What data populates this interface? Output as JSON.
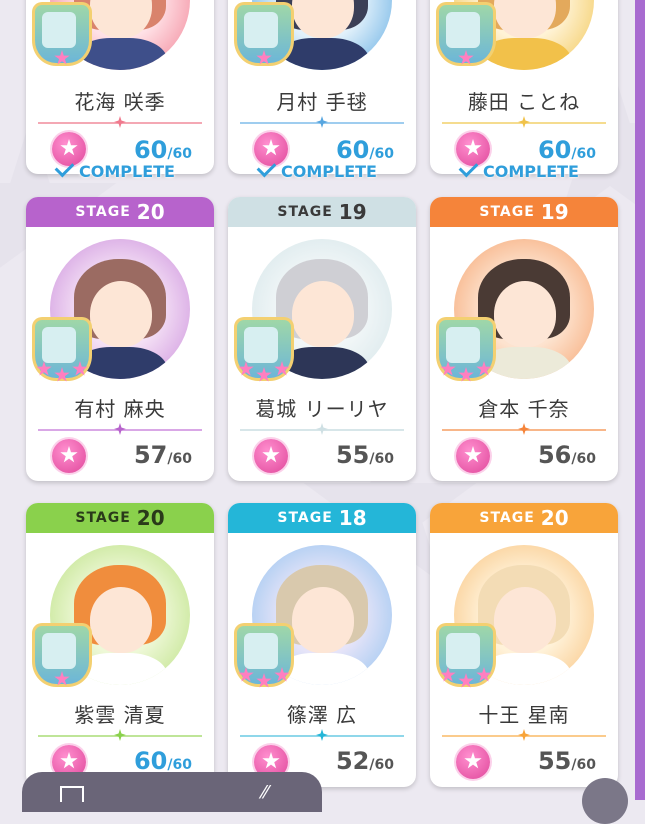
{
  "cards": [
    {
      "id": "hanami-sakiya",
      "name": "花海 咲季",
      "score": "60",
      "max": "/60",
      "full": true,
      "complete_label": "COMPLETE",
      "stage_label": "",
      "stage": "",
      "color": "#f07a8e",
      "hair": "#d9836c",
      "outfit": "#3e4f8a",
      "eye": "#4a7fd3"
    },
    {
      "id": "tsukimura-temari",
      "name": "月村 手毬",
      "score": "60",
      "max": "/60",
      "full": true,
      "complete_label": "COMPLETE",
      "stage_label": "",
      "stage": "",
      "color": "#57a6e0",
      "hair": "#3b3f56",
      "outfit": "#2f3c6a",
      "eye": "#4b6db8"
    },
    {
      "id": "fujita-kotone",
      "name": "藤田 ことね",
      "score": "60",
      "max": "/60",
      "full": true,
      "complete_label": "COMPLETE",
      "stage_label": "",
      "stage": "",
      "color": "#f0c24a",
      "hair": "#e3a95c",
      "outfit": "#f2c14a",
      "eye": "#6a8b3b"
    },
    {
      "id": "arimura-mao",
      "name": "有村 麻央",
      "score": "57",
      "max": "/60",
      "full": false,
      "complete_label": "",
      "stage_label": "STAGE",
      "stage": "20",
      "color": "#b763cc",
      "hair": "#9b6b62",
      "outfit": "#2f3c6a",
      "eye": "#6c6fd0"
    },
    {
      "id": "katsuragi-lilja",
      "name": "葛城 リーリヤ",
      "score": "55",
      "max": "/60",
      "full": false,
      "complete_label": "",
      "stage_label": "STAGE",
      "stage": "19",
      "color": "#cfe0e4",
      "hair": "#cfcfd4",
      "outfit": "#2d3657",
      "eye": "#6aa0d8"
    },
    {
      "id": "kuramoto-china",
      "name": "倉本 千奈",
      "score": "56",
      "max": "/60",
      "full": false,
      "complete_label": "",
      "stage_label": "STAGE",
      "stage": "19",
      "color": "#f5843a",
      "hair": "#4a3a34",
      "outfit": "#ecead9",
      "eye": "#8a6a2e"
    },
    {
      "id": "shiun-sumika",
      "name": "紫雲 清夏",
      "score": "60",
      "max": "/60",
      "full": true,
      "complete_label": "",
      "stage_label": "STAGE",
      "stage": "20",
      "color": "#8ad14c",
      "hair": "#f08d3d",
      "outfit": "#ffffff",
      "eye": "#4a9b5d"
    },
    {
      "id": "shinosawa-hiro",
      "name": "篠澤 広",
      "score": "52",
      "max": "/60",
      "full": false,
      "complete_label": "",
      "stage_label": "STAGE",
      "stage": "18",
      "color": "#24b6d8",
      "hair": "#d9c9ad",
      "outfit": "#ffffff",
      "eye": "#d97a3a"
    },
    {
      "id": "juo-sena",
      "name": "十王 星南",
      "score": "55",
      "max": "/60",
      "full": false,
      "complete_label": "",
      "stage_label": "STAGE",
      "stage": "20",
      "color": "#f8a43a",
      "hair": "#f3dcb5",
      "outfit": "#ffffff",
      "eye": "#8b78c9"
    }
  ]
}
